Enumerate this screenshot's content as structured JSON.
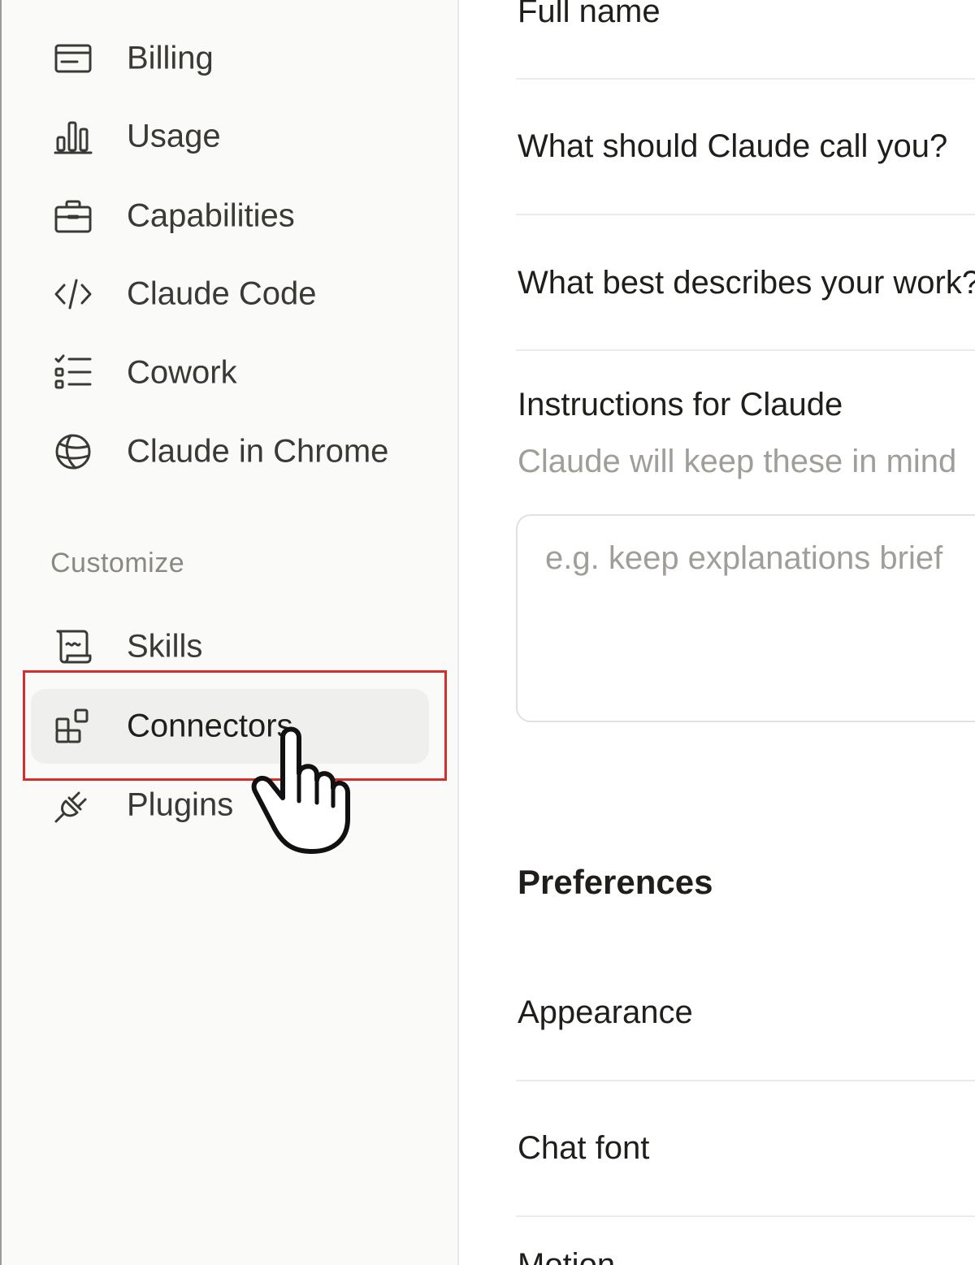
{
  "sidebar": {
    "items": [
      {
        "label": "Billing",
        "icon": "credit-card-icon"
      },
      {
        "label": "Usage",
        "icon": "bar-chart-icon"
      },
      {
        "label": "Capabilities",
        "icon": "briefcase-icon"
      },
      {
        "label": "Claude Code",
        "icon": "code-icon"
      },
      {
        "label": "Cowork",
        "icon": "checklist-icon"
      },
      {
        "label": "Claude in Chrome",
        "icon": "globe-icon"
      }
    ],
    "customize_label": "Customize",
    "customize_items": [
      {
        "label": "Skills",
        "icon": "scroll-icon"
      },
      {
        "label": "Connectors",
        "icon": "connectors-grid-icon",
        "active": true
      },
      {
        "label": "Plugins",
        "icon": "plug-icon"
      }
    ]
  },
  "main": {
    "full_name_label": "Full name",
    "call_you_label": "What should Claude call you?",
    "work_label": "What best describes your work?",
    "instructions_label": "Instructions for Claude",
    "instructions_hint": "Claude will keep these in mind",
    "instructions_placeholder": "e.g. keep explanations brief",
    "preferences_heading": "Preferences",
    "appearance_label": "Appearance",
    "chat_font_label": "Chat font",
    "motion_label": "Motion"
  },
  "colors": {
    "highlight": "#d32f2f",
    "active_bg": "#efefed",
    "sidebar_bg": "#fafaf9"
  }
}
